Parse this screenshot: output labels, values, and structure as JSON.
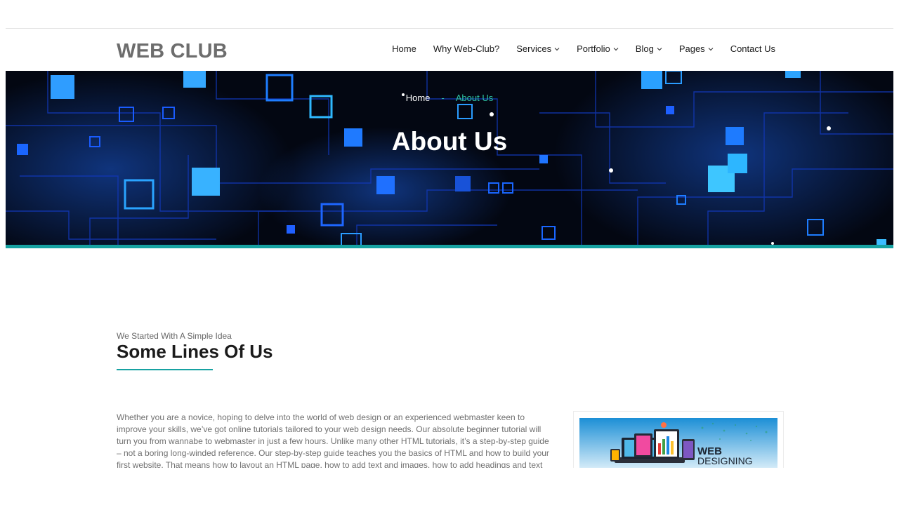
{
  "header": {
    "logo": "WEB CLUB",
    "nav": [
      {
        "label": "Home",
        "dropdown": false
      },
      {
        "label": "Why Web-Club?",
        "dropdown": false
      },
      {
        "label": "Services",
        "dropdown": true
      },
      {
        "label": "Portfolio",
        "dropdown": true
      },
      {
        "label": "Blog",
        "dropdown": true
      },
      {
        "label": "Pages",
        "dropdown": true
      },
      {
        "label": "Contact Us",
        "dropdown": false
      }
    ]
  },
  "hero": {
    "breadcrumb": {
      "home": "Home",
      "separator": "-",
      "current": "About Us"
    },
    "title": "About Us"
  },
  "about": {
    "eyebrow": "We Started With A Simple Idea",
    "title": "Some Lines Of Us",
    "paragraph": "Whether you are a novice, hoping to delve into the world of web design or an experienced webmaster keen to improve your skills, we’ve got online tutorials tailored to your web design needs. Our absolute beginner tutorial will turn you from wannabe to webmaster in just a few hours. Unlike many other HTML tutorials, it’s a step-by-step guide – not a boring long-winded reference. Our step-by-step guide teaches you the basics of HTML and how to build your first website. That means how to layout an HTML page, how to add text and images, how to add headings and text formatting, and how to",
    "image_text": {
      "line1": "WEB",
      "line2": "DESIGNING"
    }
  },
  "colors": {
    "accent": "#17a2a2",
    "breadcrumb_active": "#2ec4a4",
    "logo": "#6d6d6d",
    "hero_bg": "#030712"
  }
}
